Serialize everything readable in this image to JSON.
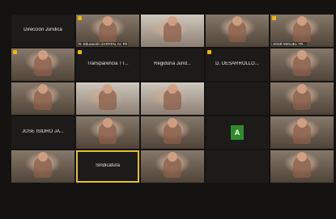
{
  "meeting": {
    "tiles": [
      {
        "caption": "Dirección Jurídica",
        "type": "dark",
        "hand": false
      },
      {
        "caption": "R. Educación ZAPATAL Ar. Pé",
        "type": "video",
        "hand": true
      },
      {
        "caption": "",
        "type": "wall",
        "hand": false
      },
      {
        "caption": "",
        "type": "video",
        "hand": false
      },
      {
        "caption": "JOSÉ MIGUEL TR...",
        "type": "video",
        "hand": true
      },
      {
        "caption": "",
        "type": "video",
        "hand": true
      },
      {
        "caption": "Transparencia TT...",
        "type": "dark",
        "hand": true
      },
      {
        "caption": "Regiduría Jurid...",
        "type": "dark",
        "hand": false
      },
      {
        "caption": "D. DESARROLLO...",
        "type": "dark",
        "hand": true
      },
      {
        "caption": "",
        "type": "video",
        "hand": false
      },
      {
        "caption": "",
        "type": "video",
        "hand": false
      },
      {
        "caption": "",
        "type": "wall",
        "hand": false
      },
      {
        "caption": "",
        "type": "wall",
        "hand": false
      },
      {
        "caption": "",
        "type": "dark",
        "hand": false
      },
      {
        "caption": "",
        "type": "video",
        "hand": false
      },
      {
        "caption": "JOSE ISIDRO JA...",
        "type": "dark",
        "hand": false
      },
      {
        "caption": "",
        "type": "video",
        "hand": false
      },
      {
        "caption": "",
        "type": "video",
        "hand": false
      },
      {
        "caption": "",
        "type": "dark",
        "hand": false,
        "avatar": "A"
      },
      {
        "caption": "",
        "type": "video",
        "hand": false
      },
      {
        "caption": "",
        "type": "video",
        "hand": false
      },
      {
        "caption": "Sindicatura",
        "type": "dark",
        "hand": false,
        "active": true
      },
      {
        "caption": "",
        "type": "video",
        "hand": false
      },
      {
        "caption": "",
        "type": "dark",
        "hand": false
      },
      {
        "caption": "",
        "type": "video",
        "hand": false
      }
    ]
  }
}
